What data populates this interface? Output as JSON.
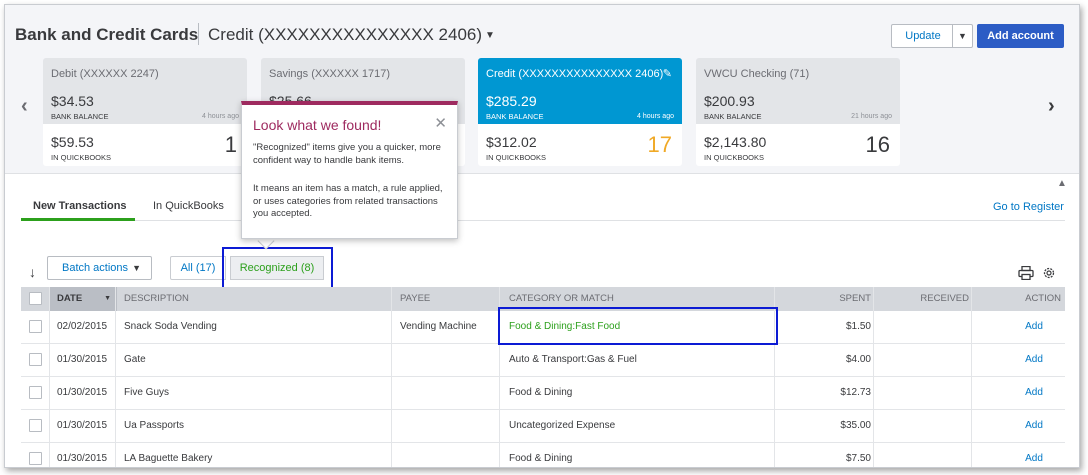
{
  "header": {
    "title": "Bank and Credit Cards",
    "account_selector": "Credit (XXXXXXXXXXXXXXX 2406)",
    "update_label": "Update",
    "add_account_label": "Add account"
  },
  "cards": [
    {
      "name": "Debit (XXXXXX 2247)",
      "bank_balance": "$34.53",
      "bank_label": "BANK BALANCE",
      "updated": "4 hours ago",
      "qb_balance": "$59.53",
      "qb_label": "IN QUICKBOOKS",
      "count": "1"
    },
    {
      "name": "Savings (XXXXXX 1717)",
      "bank_balance": "$25.66",
      "bank_label": "",
      "updated": "",
      "qb_balance": "",
      "qb_label": "",
      "count": ""
    },
    {
      "name": "Credit (XXXXXXXXXXXXXXX 2406)",
      "bank_balance": "$285.29",
      "bank_label": "BANK BALANCE",
      "updated": "4 hours ago",
      "qb_balance": "$312.02",
      "qb_label": "IN QUICKBOOKS",
      "count": "17"
    },
    {
      "name": "VWCU Checking (71)",
      "bank_balance": "$200.93",
      "bank_label": "BANK BALANCE",
      "updated": "21 hours ago",
      "qb_balance": "$2,143.80",
      "qb_label": "IN QUICKBOOKS",
      "count": "16"
    }
  ],
  "tabs": {
    "new_transactions": "New Transactions",
    "in_quickbooks": "In QuickBooks",
    "go_to_register": "Go to Register"
  },
  "toolbar": {
    "batch_actions": "Batch actions",
    "filter_all": "All (17)",
    "filter_recognized": "Recognized (8)"
  },
  "popover": {
    "title": "Look what we found!",
    "para1": "\"Recognized\" items give you a quicker, more confident way to handle bank items.",
    "para2": "It means an item has a match, a rule applied, or uses categories from related transactions you accepted."
  },
  "table": {
    "columns": {
      "date": "DATE",
      "description": "DESCRIPTION",
      "payee": "PAYEE",
      "category": "CATEGORY OR MATCH",
      "spent": "SPENT",
      "received": "RECEIVED",
      "action": "ACTION"
    },
    "rows": [
      {
        "date": "02/02/2015",
        "description": "Snack Soda Vending",
        "payee": "Vending Machine",
        "category": "Food & Dining:Fast Food",
        "spent": "$1.50",
        "received": "",
        "action": "Add"
      },
      {
        "date": "01/30/2015",
        "description": "Gate",
        "payee": "",
        "category": "Auto & Transport:Gas & Fuel",
        "spent": "$4.00",
        "received": "",
        "action": "Add"
      },
      {
        "date": "01/30/2015",
        "description": "Five Guys",
        "payee": "",
        "category": "Food & Dining",
        "spent": "$12.73",
        "received": "",
        "action": "Add"
      },
      {
        "date": "01/30/2015",
        "description": "Ua Passports",
        "payee": "",
        "category": "Uncategorized Expense",
        "spent": "$35.00",
        "received": "",
        "action": "Add"
      },
      {
        "date": "01/30/2015",
        "description": "LA Baguette Bakery",
        "payee": "",
        "category": "Food & Dining",
        "spent": "$7.50",
        "received": "",
        "action": "Add"
      }
    ]
  },
  "colors": {
    "accent_green": "#2ca01c",
    "link_blue": "#0077c5",
    "active_card": "#0097d2",
    "popover_accent": "#9e2a5f",
    "highlight_box": "#0c1bd4"
  }
}
